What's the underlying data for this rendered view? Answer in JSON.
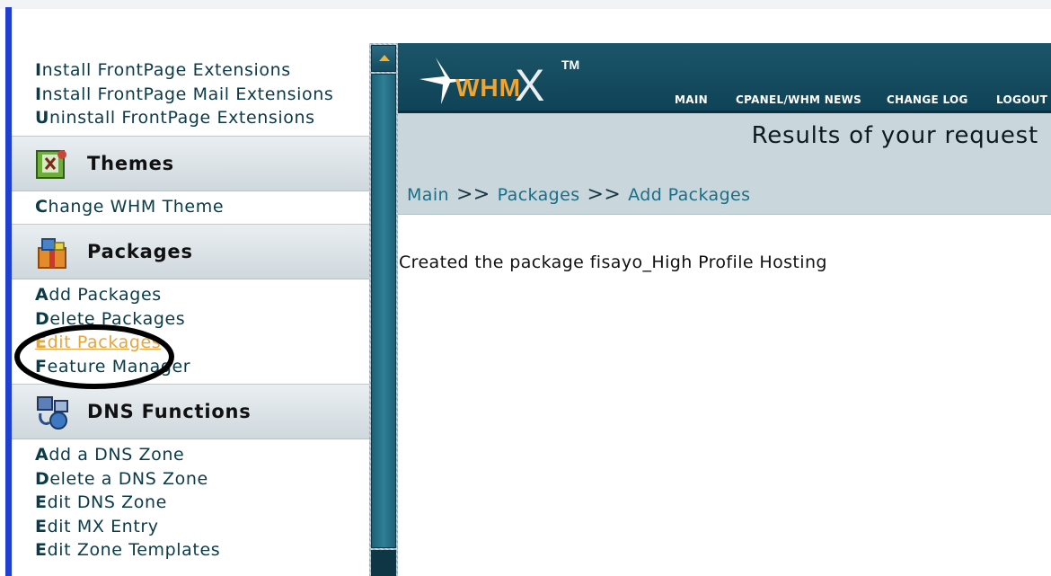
{
  "sidebar": {
    "frontpage_links": [
      {
        "first": "I",
        "rest": "nstall FrontPage Extensions"
      },
      {
        "first": "I",
        "rest": "nstall FrontPage Mail Extensions"
      },
      {
        "first": "U",
        "rest": "ninstall FrontPage Extensions"
      }
    ],
    "themes": {
      "title": "Themes",
      "links": [
        {
          "first": "C",
          "rest": "hange WHM Theme"
        }
      ]
    },
    "packages": {
      "title": "Packages",
      "links": [
        {
          "first": "A",
          "rest": "dd Packages"
        },
        {
          "first": "D",
          "rest": "elete Packages"
        },
        {
          "first": "E",
          "rest": "dit Packages"
        },
        {
          "first": "F",
          "rest": "eature Manager"
        }
      ]
    },
    "dns": {
      "title": "DNS Functions",
      "links": [
        {
          "first": "A",
          "rest": "dd a DNS Zone"
        },
        {
          "first": "D",
          "rest": "elete a DNS Zone"
        },
        {
          "first": "E",
          "rest": "dit DNS Zone"
        },
        {
          "first": "E",
          "rest": "dit MX Entry"
        },
        {
          "first": "E",
          "rest": "dit Zone Templates"
        }
      ]
    }
  },
  "header": {
    "logo": {
      "text": "WHM",
      "x": "X",
      "tm": "TM"
    },
    "nav": [
      "MAIN",
      "CPANEL/WHM NEWS",
      "CHANGE LOG",
      "LOGOUT"
    ]
  },
  "content": {
    "title": "Results of your request",
    "breadcrumb": [
      "Main",
      "Packages",
      "Add Packages"
    ],
    "breadcrumb_separator": ">>",
    "message": "Created the package fisayo_High Profile Hosting"
  },
  "icons": {
    "themes": "themes-icon",
    "packages": "packages-icon",
    "dns": "dns-icon",
    "scroll_up": "arrow-up-icon"
  },
  "colors": {
    "header_bg": "#1b5569",
    "panel_bg": "#c9d6dc",
    "link": "#0b3b49",
    "highlight_link": "#e8a63a",
    "breadcrumb": "#1c6e86",
    "logo_orange": "#f0a531"
  }
}
